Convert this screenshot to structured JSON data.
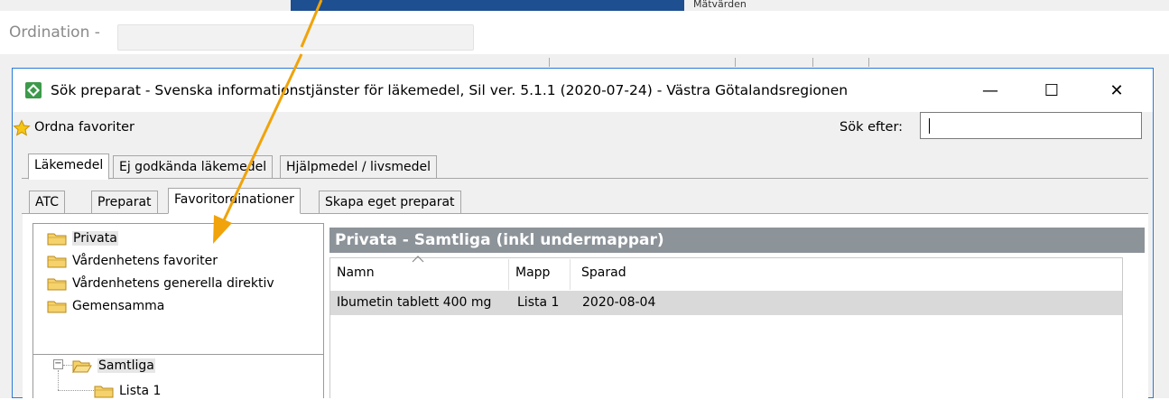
{
  "background_window": {
    "title": "Ordination -",
    "partial_tab_text": "Mätvärden"
  },
  "dialog": {
    "title": "Sök preparat - Svenska informationstjänster för läkemedel, Sil ver. 5.1.1 (2020-07-24) - Västra Götalandsregionen",
    "favorites_label": "Ordna favoriter",
    "search_label": "Sök efter:",
    "search_value": "",
    "window_buttons": {
      "minimize": "—",
      "maximize": "☐",
      "close": "✕"
    }
  },
  "tabs_top": [
    "Läkemedel",
    "Ej godkända läkemedel",
    "Hjälpmedel / livsmedel"
  ],
  "tabs_sub": [
    "ATC",
    "Preparat",
    "Favoritordinationer",
    "Skapa eget preparat"
  ],
  "folders": [
    "Privata",
    "Vårdenhetens favoriter",
    "Vårdenhetens generella direktiv",
    "Gemensamma"
  ],
  "tree": {
    "root": "Samtliga",
    "expander": "−",
    "child": "Lista 1"
  },
  "results": {
    "header": "Privata - Samtliga (inkl undermappar)",
    "columns": [
      "Namn",
      "Mapp",
      "Sparad"
    ],
    "rows": [
      {
        "namn": "Ibumetin tablett 400 mg",
        "mapp": "Lista 1",
        "sparad": "2020-08-04"
      }
    ]
  },
  "colors": {
    "accent_border": "#2a7ad8",
    "header_bg": "#8c9399",
    "arrow": "#f0a30a",
    "folder_yellow": "#f5d26b"
  }
}
